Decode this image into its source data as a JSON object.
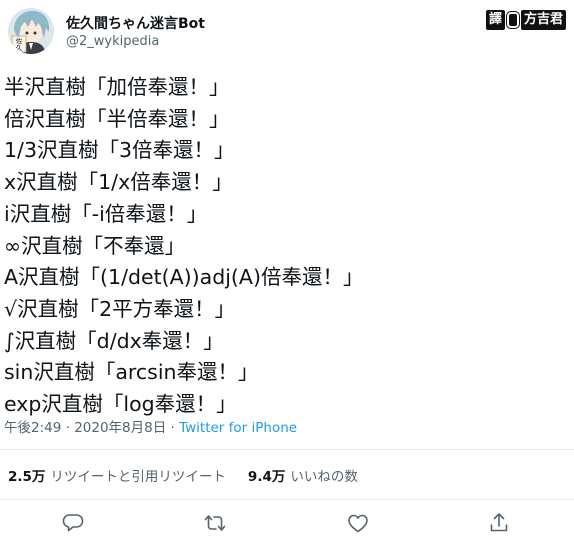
{
  "header": {
    "display_name": "佐久間ちゃん迷言Bot",
    "handle": "@2_wykipedia",
    "avatar_text_1": "佐",
    "avatar_text_2": "久"
  },
  "watermark": {
    "left": "譯",
    "right": "方吉君"
  },
  "tweet": {
    "lines": [
      "半沢直樹「加倍奉還！」",
      "倍沢直樹「半倍奉還！」",
      "1/3沢直樹「3倍奉還！」",
      "x沢直樹「1/x倍奉還！」",
      "i沢直樹「-i倍奉還！」",
      "∞沢直樹「不奉還」",
      "A沢直樹「(1/det(A))adj(A)倍奉還！」",
      "√沢直樹「2平方奉還！」",
      "∫沢直樹「d/dx奉還！」",
      "sin沢直樹「arcsin奉還！」",
      "exp沢直樹「log奉還！」"
    ]
  },
  "meta": {
    "timestamp": "午後2:49 · 2020年8月8日 · ",
    "source": "Twitter for iPhone"
  },
  "stats": {
    "retweets_count": "2.5万",
    "retweets_label": "リツイートと引用リツイート",
    "likes_count": "9.4万",
    "likes_label": "いいねの数"
  },
  "actions": {
    "icons": [
      "reply-icon",
      "retweet-icon",
      "like-icon",
      "share-icon"
    ]
  },
  "colors": {
    "text": "#0f1419",
    "secondary": "#536471",
    "link": "#1d9bf0",
    "divider": "#e6ecf0"
  }
}
